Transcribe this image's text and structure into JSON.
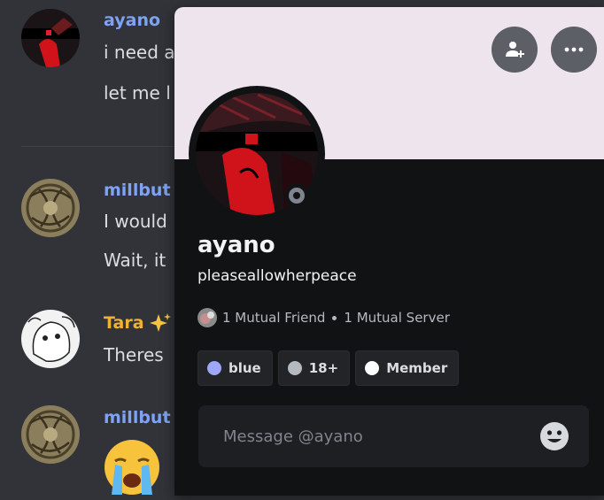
{
  "chat": {
    "messages": [
      {
        "author": "ayano",
        "lines": [
          "i need a",
          "let me l"
        ],
        "author_color": "#7ea3f5"
      },
      {
        "author": "millbut",
        "lines": [
          "I would",
          "Wait, it"
        ],
        "author_color": "#7ea3f5"
      },
      {
        "author": "Tara",
        "lines": [
          "Theres"
        ],
        "author_color": "#f0b232",
        "badge_icon": "sparkles-icon"
      },
      {
        "author": "millbut",
        "lines": [],
        "author_color": "#7ea3f5",
        "emoji": "loudly-crying-face-icon"
      }
    ]
  },
  "profile": {
    "display_name": "ayano",
    "username": "pleaseallowherpeace",
    "status": "offline",
    "mutual_friends": "1 Mutual Friend",
    "mutual_servers": "1 Mutual Server",
    "roles": [
      {
        "label": "blue",
        "color": "#9ea7f7"
      },
      {
        "label": "18+",
        "color": "#b5bac1"
      },
      {
        "label": "Member",
        "color": "#ffffff"
      }
    ],
    "message_placeholder": "Message @ayano",
    "banner_color": "#ede4ee",
    "actions": [
      "add-friend-icon",
      "more-options-icon"
    ]
  }
}
